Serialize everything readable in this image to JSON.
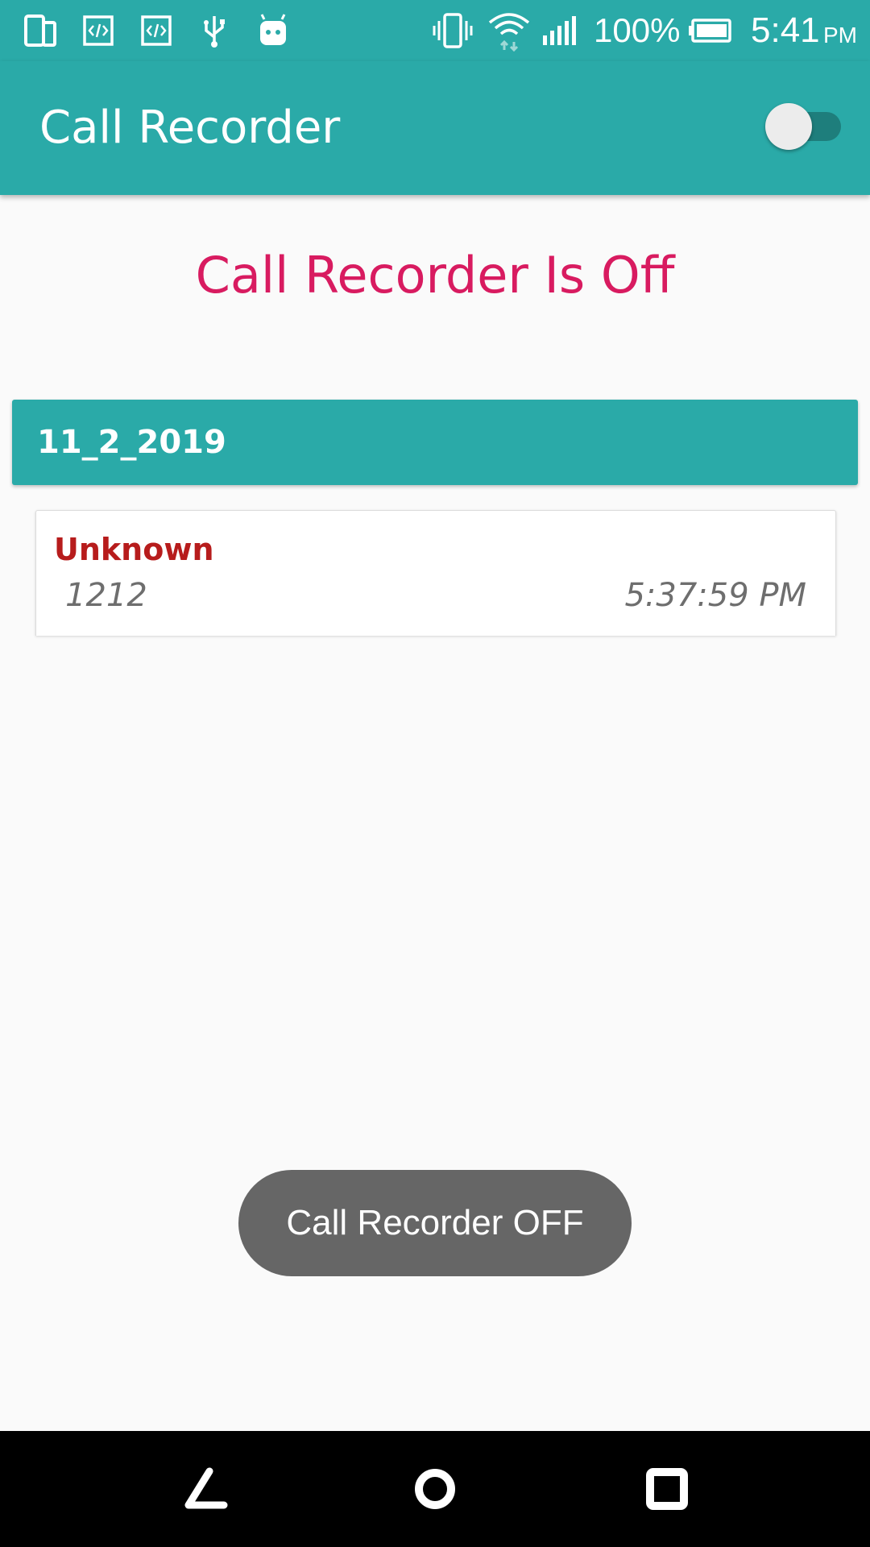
{
  "status_bar": {
    "battery_percent": "100%",
    "time": "5:41",
    "ampm": "PM",
    "icons": [
      "phone-dual-icon",
      "code-icon",
      "code-icon",
      "usb-icon",
      "android-icon",
      "vibrate-icon",
      "wifi-icon",
      "signal-icon",
      "battery-icon"
    ]
  },
  "app_bar": {
    "title": "Call Recorder",
    "toggle_on": false
  },
  "main": {
    "status_heading": "Call Recorder Is Off",
    "date_header": "11_2_2019",
    "calls": [
      {
        "name": "Unknown",
        "number": "1212",
        "time": "5:37:59 PM"
      }
    ]
  },
  "toast": {
    "message": "Call Recorder OFF"
  },
  "nav_bar": {
    "icons": [
      "back-icon",
      "home-icon",
      "recents-icon"
    ]
  },
  "colors": {
    "primary": "#2aaaa8",
    "primary_dark": "#1e7e7c",
    "accent": "#d81b60",
    "caller_name": "#b71c1c",
    "background": "#fafafa"
  }
}
